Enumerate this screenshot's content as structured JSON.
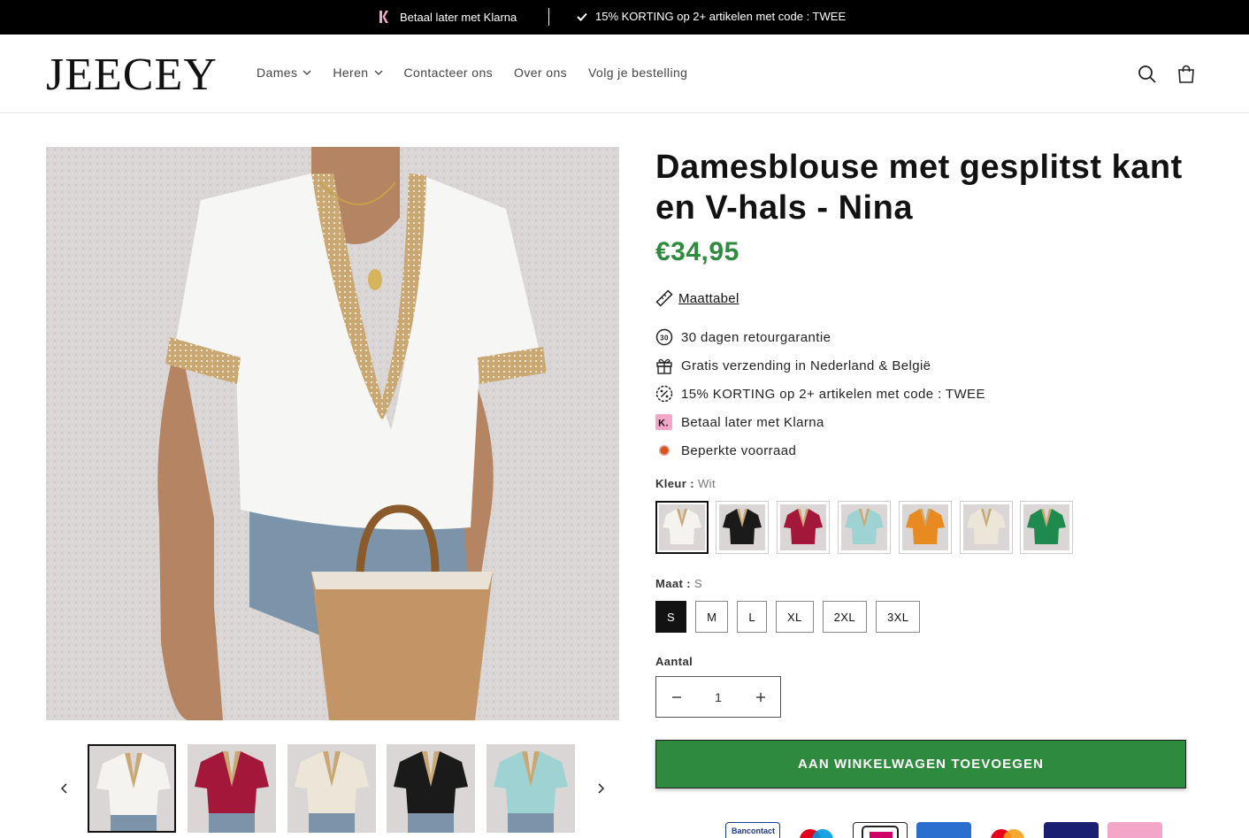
{
  "announcement": {
    "klarna_text": "Betaal later met Klarna",
    "discount_text": "15% KORTING op 2+ artikelen met code : TWEE"
  },
  "header": {
    "logo": "JEECEY",
    "nav": [
      {
        "label": "Dames",
        "has_dropdown": true
      },
      {
        "label": "Heren",
        "has_dropdown": true
      },
      {
        "label": "Contacteer ons",
        "has_dropdown": false
      },
      {
        "label": "Over ons",
        "has_dropdown": false
      },
      {
        "label": "Volg je bestelling",
        "has_dropdown": false
      }
    ],
    "icons": [
      "search-icon",
      "cart-icon"
    ]
  },
  "gallery": {
    "thumbnails": [
      {
        "color": "Wit",
        "hex": "#f4f3f0"
      },
      {
        "color": "Rood",
        "hex": "#a3173b"
      },
      {
        "color": "Beige",
        "hex": "#ece6d8"
      },
      {
        "color": "Zwart",
        "hex": "#1a1a1a"
      },
      {
        "color": "Lichtblauw",
        "hex": "#9fd3d3"
      }
    ]
  },
  "product": {
    "title": "Damesblouse met gesplitst kant en V-hals - Nina",
    "price": "€34,95",
    "size_chart_label": "Maattabel",
    "features": [
      {
        "icon": "30-days-icon",
        "text": "30 dagen retourgarantie"
      },
      {
        "icon": "gift-icon",
        "text": "Gratis verzending in Nederland & België"
      },
      {
        "icon": "discount-icon",
        "text": "15% KORTING op 2+ artikelen met code : TWEE"
      },
      {
        "icon": "klarna-icon",
        "text": "Betaal later met Klarna"
      },
      {
        "icon": "stock-dot-icon",
        "text": "Beperkte voorraad"
      }
    ],
    "color_label": "Kleur :",
    "color_value": "Wit",
    "colors": [
      {
        "name": "Wit",
        "hex": "#f4f3f0"
      },
      {
        "name": "Zwart",
        "hex": "#1a1a1a"
      },
      {
        "name": "Rood",
        "hex": "#a3173b"
      },
      {
        "name": "Lichtblauw",
        "hex": "#9fd3d3"
      },
      {
        "name": "Oranje",
        "hex": "#e88a1f"
      },
      {
        "name": "Beige",
        "hex": "#ece6d8"
      },
      {
        "name": "Groen",
        "hex": "#1f8a4d"
      }
    ],
    "size_label": "Maat :",
    "size_value": "S",
    "sizes": [
      "S",
      "M",
      "L",
      "XL",
      "2XL",
      "3XL"
    ],
    "quantity_label": "Aantal",
    "quantity": "1",
    "add_to_cart": "AAN WINKELWAGEN TOEVOEGEN",
    "payment_methods": [
      "Bancontact",
      "Maestro",
      "iDEAL",
      "AMEX",
      "Mastercard",
      "VISA",
      "Klarna"
    ],
    "accent_color": "#2e8b3e"
  }
}
